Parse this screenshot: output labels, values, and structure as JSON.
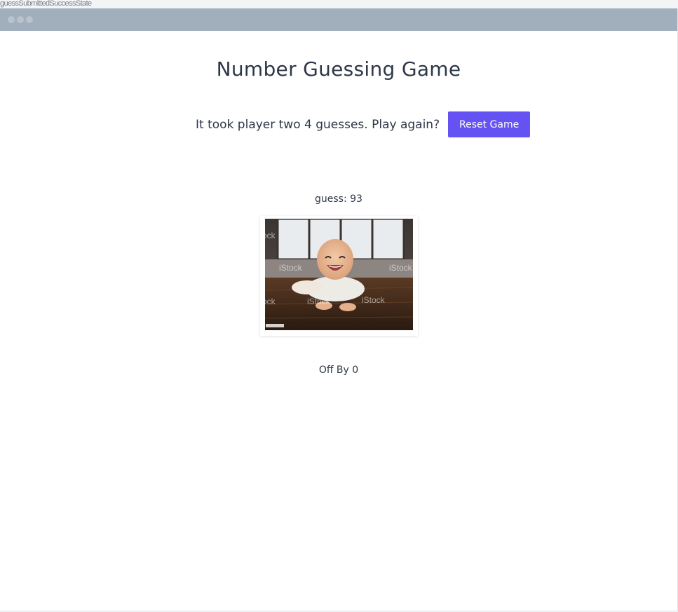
{
  "story": {
    "label": "guessSubmittedSuccessState"
  },
  "window": {
    "dots": [
      "window-dot",
      "window-dot",
      "window-dot"
    ]
  },
  "game": {
    "title": "Number Guessing Game",
    "result_message": "It took player two 4 guesses. Play again?",
    "reset_label": "Reset Game",
    "guess_label": "guess: 93",
    "off_by_label": "Off By 0"
  },
  "photo": {
    "watermark": "iStock",
    "description_icon": "laughing-baby-photo"
  },
  "colors": {
    "accent": "#6552f3",
    "titlebar": "#a1aebb",
    "text": "#2d3748"
  }
}
